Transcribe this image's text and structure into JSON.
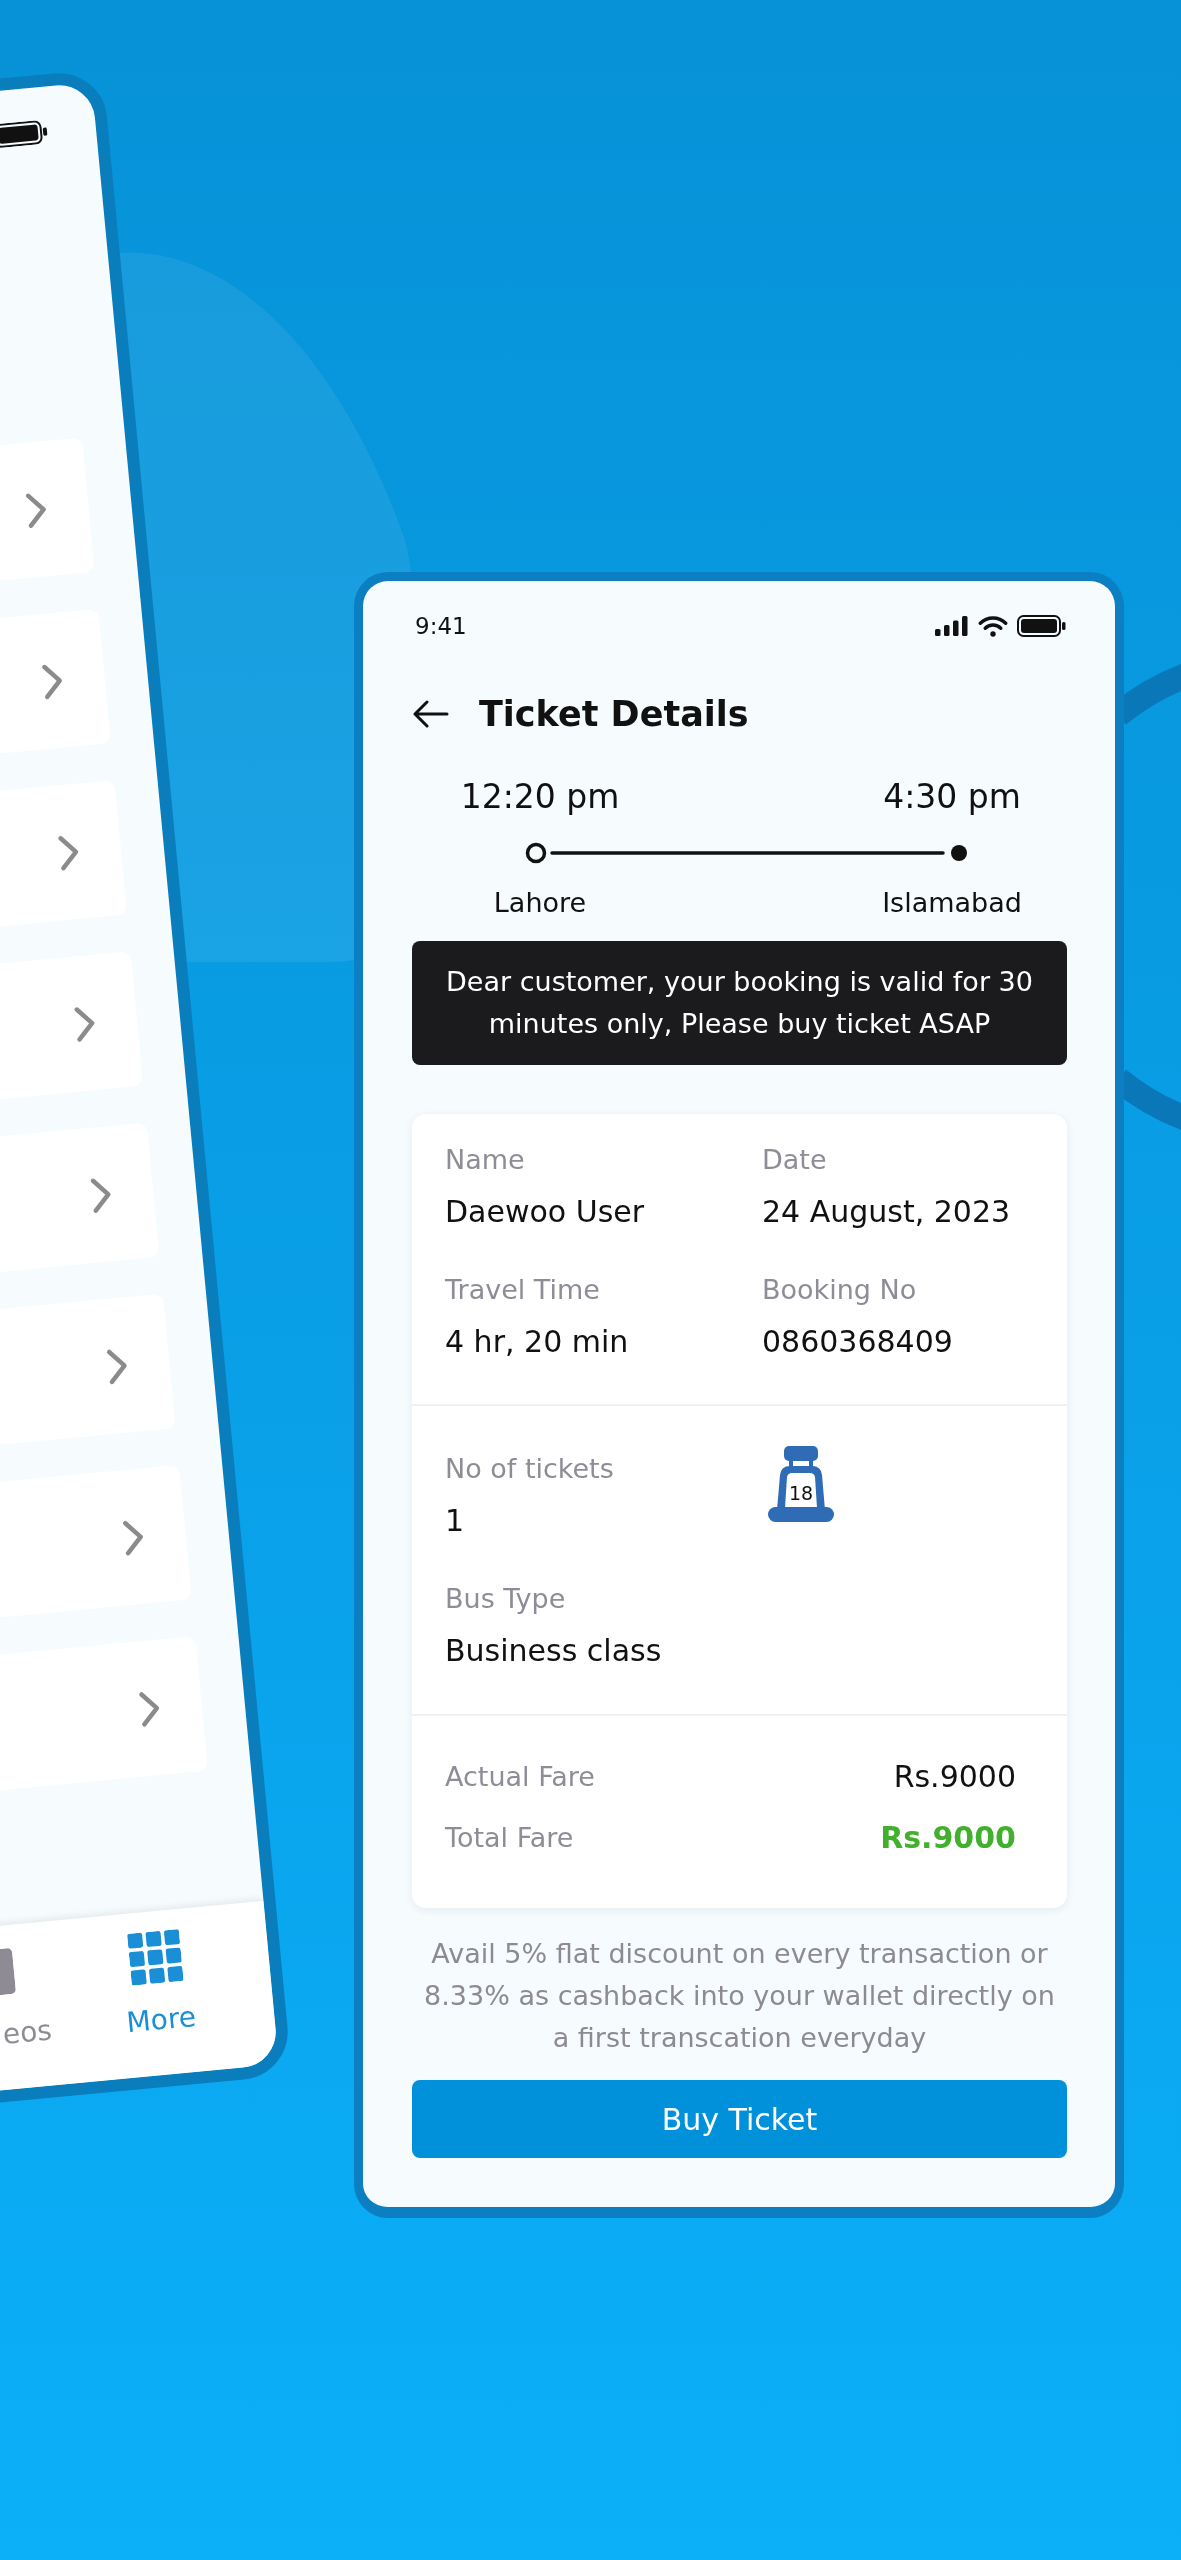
{
  "left_phone": {
    "menu_rows": [
      {
        "kind": "link"
      },
      {
        "kind": "link"
      },
      {
        "kind": "link"
      },
      {
        "kind": "link"
      },
      {
        "kind": "link"
      },
      {
        "kind": "link"
      },
      {
        "kind": "link"
      },
      {
        "kind": "link"
      }
    ],
    "tab_bar": [
      {
        "label": "eos",
        "kind": "tile",
        "selected": false
      },
      {
        "label": "More",
        "kind": "grid",
        "selected": true
      }
    ]
  },
  "ticket_screen": {
    "status_bar": {
      "time": "9:41"
    },
    "title": "Ticket Details",
    "route": {
      "departure": {
        "time": "12:20 pm",
        "city": "Lahore"
      },
      "arrival": {
        "time": "4:30 pm",
        "city": "Islamabad"
      }
    },
    "notice": "Dear customer, your booking is valid for 30 minutes only, Please buy ticket ASAP",
    "details": {
      "fields": [
        {
          "label": "Name",
          "value": "Daewoo User"
        },
        {
          "label": "Date",
          "value": "24 August, 2023"
        },
        {
          "label": "Travel Time",
          "value": "4 hr, 20 min"
        },
        {
          "label": "Booking No",
          "value": "0860368409"
        }
      ],
      "tickets": {
        "label": "No of tickets",
        "value": "1",
        "seat_number": "18"
      },
      "bus_type": {
        "label": "Bus Type",
        "value": "Business class"
      }
    },
    "fares": [
      {
        "label": "Actual Fare",
        "value": "Rs.9000",
        "kind": "actual"
      },
      {
        "label": "Total Fare",
        "value": "Rs.9000",
        "kind": "total"
      }
    ],
    "offer": "Avail 5% flat discount on every transaction or 8.33% as cashback into your wallet directly on a first transcation everyday",
    "buy_button": "Buy Ticket"
  }
}
